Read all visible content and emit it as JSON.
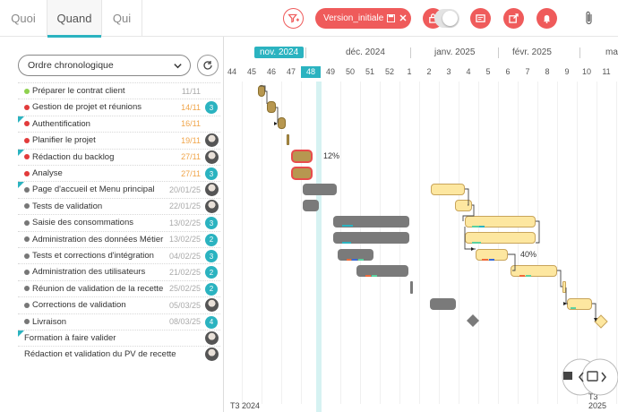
{
  "tabs": [
    {
      "label": "Quoi",
      "active": false
    },
    {
      "label": "Quand",
      "active": true
    },
    {
      "label": "Qui",
      "active": false
    }
  ],
  "toolbar": {
    "filter_icon": "filter-icon",
    "version_label": "Version_initiale",
    "save_icon": "save-icon",
    "close_icon": "close-icon",
    "lock_icon": "lock-icon",
    "card_icon": "card-icon",
    "export_icon": "export-icon",
    "bell_icon": "bell-icon",
    "attach_icon": "paperclip-icon",
    "accent": "#ef5b5b"
  },
  "order_select": {
    "value": "Ordre chronologique"
  },
  "tasks": [
    {
      "name": "Préparer le contrat client",
      "date": "11/11",
      "date_color": "gray",
      "status": "#8fd14f",
      "badge": "",
      "avatar": false,
      "indicator": false
    },
    {
      "name": "Gestion de projet et réunions",
      "date": "14/11",
      "date_color": "orange",
      "status": "#e23b3b",
      "badge": "3",
      "avatar": false,
      "indicator": false
    },
    {
      "name": "Authentification",
      "date": "16/11",
      "date_color": "orange",
      "status": "#e23b3b",
      "badge": "",
      "avatar": false,
      "indicator": true
    },
    {
      "name": "Planifier le projet",
      "date": "19/11",
      "date_color": "orange",
      "status": "#e23b3b",
      "badge": "",
      "avatar": true,
      "indicator": false
    },
    {
      "name": "Rédaction du backlog",
      "date": "27/11",
      "date_color": "orange",
      "status": "#e23b3b",
      "badge": "",
      "avatar": true,
      "indicator": true
    },
    {
      "name": "Analyse",
      "date": "27/11",
      "date_color": "orange",
      "status": "#e23b3b",
      "badge": "3",
      "avatar": false,
      "indicator": false
    },
    {
      "name": "Page d'accueil et Menu principal",
      "date": "20/01/25",
      "date_color": "gray",
      "status": "#777777",
      "badge": "",
      "avatar": true,
      "indicator": true
    },
    {
      "name": "Tests de validation",
      "date": "22/01/25",
      "date_color": "gray",
      "status": "#777777",
      "badge": "",
      "avatar": true,
      "indicator": false
    },
    {
      "name": "Saisie des consommations",
      "date": "13/02/25",
      "date_color": "gray",
      "status": "#777777",
      "badge": "3",
      "avatar": false,
      "indicator": false
    },
    {
      "name": "Administration des données Métier",
      "date": "13/02/25",
      "date_color": "gray",
      "status": "#777777",
      "badge": "2",
      "avatar": false,
      "indicator": false
    },
    {
      "name": "Tests et corrections d'intégration",
      "date": "04/02/25",
      "date_color": "gray",
      "status": "#777777",
      "badge": "3",
      "avatar": false,
      "indicator": false
    },
    {
      "name": "Administration des utilisateurs",
      "date": "21/02/25",
      "date_color": "gray",
      "status": "#777777",
      "badge": "2",
      "avatar": false,
      "indicator": false
    },
    {
      "name": "Réunion de validation de la recette",
      "date": "25/02/25",
      "date_color": "gray",
      "status": "#777777",
      "badge": "2",
      "avatar": false,
      "indicator": false
    },
    {
      "name": "Corrections de validation",
      "date": "05/03/25",
      "date_color": "gray",
      "status": "#777777",
      "badge": "",
      "avatar": true,
      "indicator": false
    },
    {
      "name": "Livraison",
      "date": "08/03/25",
      "date_color": "gray",
      "status": "#777777",
      "badge": "4",
      "avatar": false,
      "indicator": false
    },
    {
      "name": "Formation à faire valider",
      "date": "",
      "date_color": "gray",
      "status": "",
      "badge": "",
      "avatar": true,
      "indicator": true
    },
    {
      "name": "Rédaction et validation du PV de recette",
      "date": "",
      "date_color": "gray",
      "status": "",
      "badge": "",
      "avatar": true,
      "indicator": false
    }
  ],
  "timeline": {
    "months": [
      "nov. 2024",
      "déc. 2024",
      "janv. 2025",
      "févr. 2025",
      "mar"
    ],
    "current_month": "nov. 2024",
    "weeks": [
      "44",
      "45",
      "46",
      "47",
      "48",
      "49",
      "50",
      "51",
      "52",
      "1",
      "2",
      "3",
      "4",
      "5",
      "6",
      "7",
      "8",
      "9",
      "10",
      "11"
    ],
    "current_week": "48",
    "progress_labels": [
      "12%",
      "40%"
    ],
    "footer_left": "T3 2024",
    "footer_right": "T3 2025",
    "accent": "#2bb3c0"
  }
}
